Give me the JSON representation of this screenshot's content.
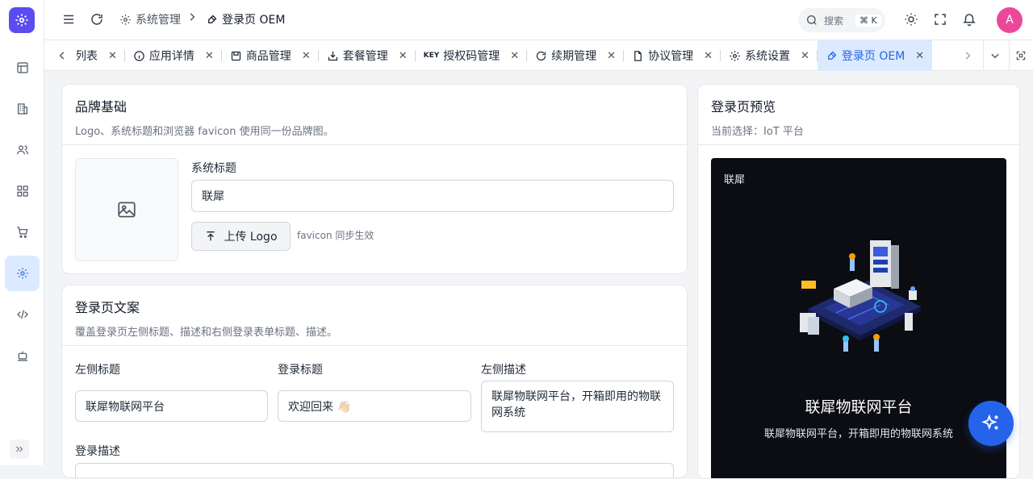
{
  "header": {
    "breadcrumb": [
      "系统管理",
      "登录页 OEM"
    ],
    "search_placeholder": "搜索",
    "search_shortcut": "⌘ K",
    "avatar_initial": "A"
  },
  "tabs": [
    {
      "label": "用列表",
      "icon": "list-icon"
    },
    {
      "label": "应用详情",
      "icon": "info-icon"
    },
    {
      "label": "商品管理",
      "icon": "product-icon"
    },
    {
      "label": "套餐管理",
      "icon": "package-icon"
    },
    {
      "label": "授权码管理",
      "icon": "key-icon",
      "badge": "KEY"
    },
    {
      "label": "续期管理",
      "icon": "refresh-icon"
    },
    {
      "label": "协议管理",
      "icon": "file-icon"
    },
    {
      "label": "系统设置",
      "icon": "gear-icon"
    },
    {
      "label": "登录页 OEM",
      "icon": "brush-icon",
      "active": true
    }
  ],
  "brand": {
    "title": "品牌基础",
    "desc": "Logo、系统标题和浏览器 favicon 使用同一份品牌图。",
    "system_title_label": "系统标题",
    "system_title_value": "联犀",
    "upload_label": "上传 Logo",
    "favicon_note": "favicon 同步生效"
  },
  "copy": {
    "title": "登录页文案",
    "desc": "覆盖登录页左侧标题、描述和右侧登录表单标题、描述。",
    "left_title_label": "左侧标题",
    "left_title_value": "联犀物联网平台",
    "login_title_label": "登录标题",
    "login_title_value": "欢迎回来 👋🏻",
    "left_desc_label": "左侧描述",
    "left_desc_value": "联犀物联网平台，开箱即用的物联网系统",
    "login_desc_label": "登录描述"
  },
  "preview": {
    "title": "登录页预览",
    "current": "当前选择：IoT 平台",
    "brand": "联犀",
    "headline": "联犀物联网平台",
    "subline": "联犀物联网平台，开箱即用的物联网系统"
  },
  "colors": {
    "accent": "#2563eb",
    "logo_bg": "#5b4cf0",
    "avatar_bg": "#ec4899"
  }
}
